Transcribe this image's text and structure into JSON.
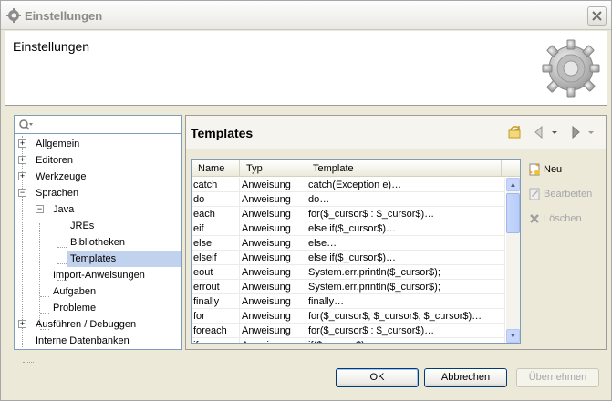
{
  "window": {
    "title": "Einstellungen"
  },
  "header": {
    "title": "Einstellungen"
  },
  "search": {
    "placeholder": ""
  },
  "tree": {
    "items": [
      {
        "label": "Allgemein"
      },
      {
        "label": "Editoren"
      },
      {
        "label": "Werkzeuge"
      },
      {
        "label": "Sprachen"
      },
      {
        "label": "Java"
      },
      {
        "label": "JREs"
      },
      {
        "label": "Bibliotheken"
      },
      {
        "label": "Templates"
      },
      {
        "label": "Import-Anweisungen"
      },
      {
        "label": "Aufgaben"
      },
      {
        "label": "Probleme"
      },
      {
        "label": "Ausführen / Debuggen"
      },
      {
        "label": "Interne Datenbanken"
      }
    ],
    "selected": "Templates"
  },
  "panel": {
    "title": "Templates"
  },
  "table": {
    "columns": [
      "Name",
      "Typ",
      "Template"
    ],
    "rows": [
      [
        "catch",
        "Anweisung",
        "catch(Exception e)…"
      ],
      [
        "do",
        "Anweisung",
        "do…"
      ],
      [
        "each",
        "Anweisung",
        "for($_cursor$ : $_cursor$)…"
      ],
      [
        "eif",
        "Anweisung",
        "else if($_cursor$)…"
      ],
      [
        "else",
        "Anweisung",
        "else…"
      ],
      [
        "elseif",
        "Anweisung",
        "else if($_cursor$)…"
      ],
      [
        "eout",
        "Anweisung",
        "System.err.println($_cursor$);"
      ],
      [
        "errout",
        "Anweisung",
        "System.err.println($_cursor$);"
      ],
      [
        "finally",
        "Anweisung",
        "finally…"
      ],
      [
        "for",
        "Anweisung",
        "for($_cursor$; $_cursor$; $_cursor$)…"
      ],
      [
        "foreach",
        "Anweisung",
        "for($_cursor$ : $_cursor$)…"
      ],
      [
        "if",
        "Anweisung",
        "if($_cursor$)…"
      ]
    ]
  },
  "actions": {
    "new": "Neu",
    "edit": "Bearbeiten",
    "delete": "Löschen"
  },
  "buttons": {
    "ok": "OK",
    "cancel": "Abbrechen",
    "apply": "Übernehmen"
  },
  "colors": {
    "selection": "#c1d2ee",
    "border": "#7f9db9",
    "window_bg": "#ece9d8"
  }
}
